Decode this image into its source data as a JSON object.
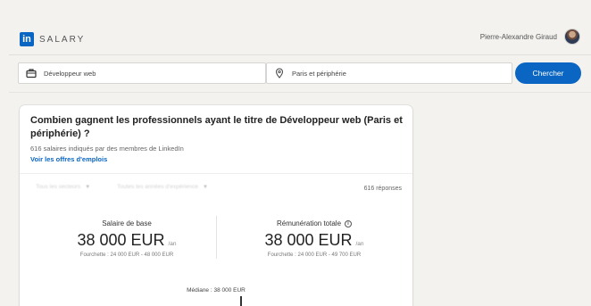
{
  "header": {
    "logo_mark": "in",
    "logo_text": "SALARY",
    "user_name": "Pierre-Alexandre Giraud"
  },
  "search": {
    "job_value": "Développeur web",
    "location_value": "Paris et périphérie",
    "button_label": "Chercher"
  },
  "card": {
    "title": "Combien gagnent les professionnels ayant le titre de Développeur web (Paris et périphérie) ?",
    "subtitle": "616 salaires indiqués par des membres de LinkedIn",
    "jobs_link": "Voir les offres d'emplois",
    "filters": [
      {
        "label": "Tous les secteurs"
      },
      {
        "label": "Toutes les années d'expérience"
      }
    ],
    "responses": "616 réponses",
    "base_salary": {
      "label": "Salaire de base",
      "amount": "38 000 EUR",
      "unit": "/an",
      "range": "Fourchette : 24 000 EUR - 48 000 EUR"
    },
    "total_comp": {
      "label": "Rémunération totale",
      "info_glyph": "i",
      "amount": "38 000 EUR",
      "unit": "/an",
      "range": "Fourchette : 24 000 EUR - 49 700 EUR"
    },
    "median_label": "Médiane : 38 000 EUR"
  },
  "colors": {
    "brand_blue": "#0a66c2",
    "page_bg": "#f3f2ef"
  },
  "icons": {
    "job_field": "briefcase-icon",
    "location_field": "location-pin-icon",
    "total_comp_info": "info-icon"
  }
}
